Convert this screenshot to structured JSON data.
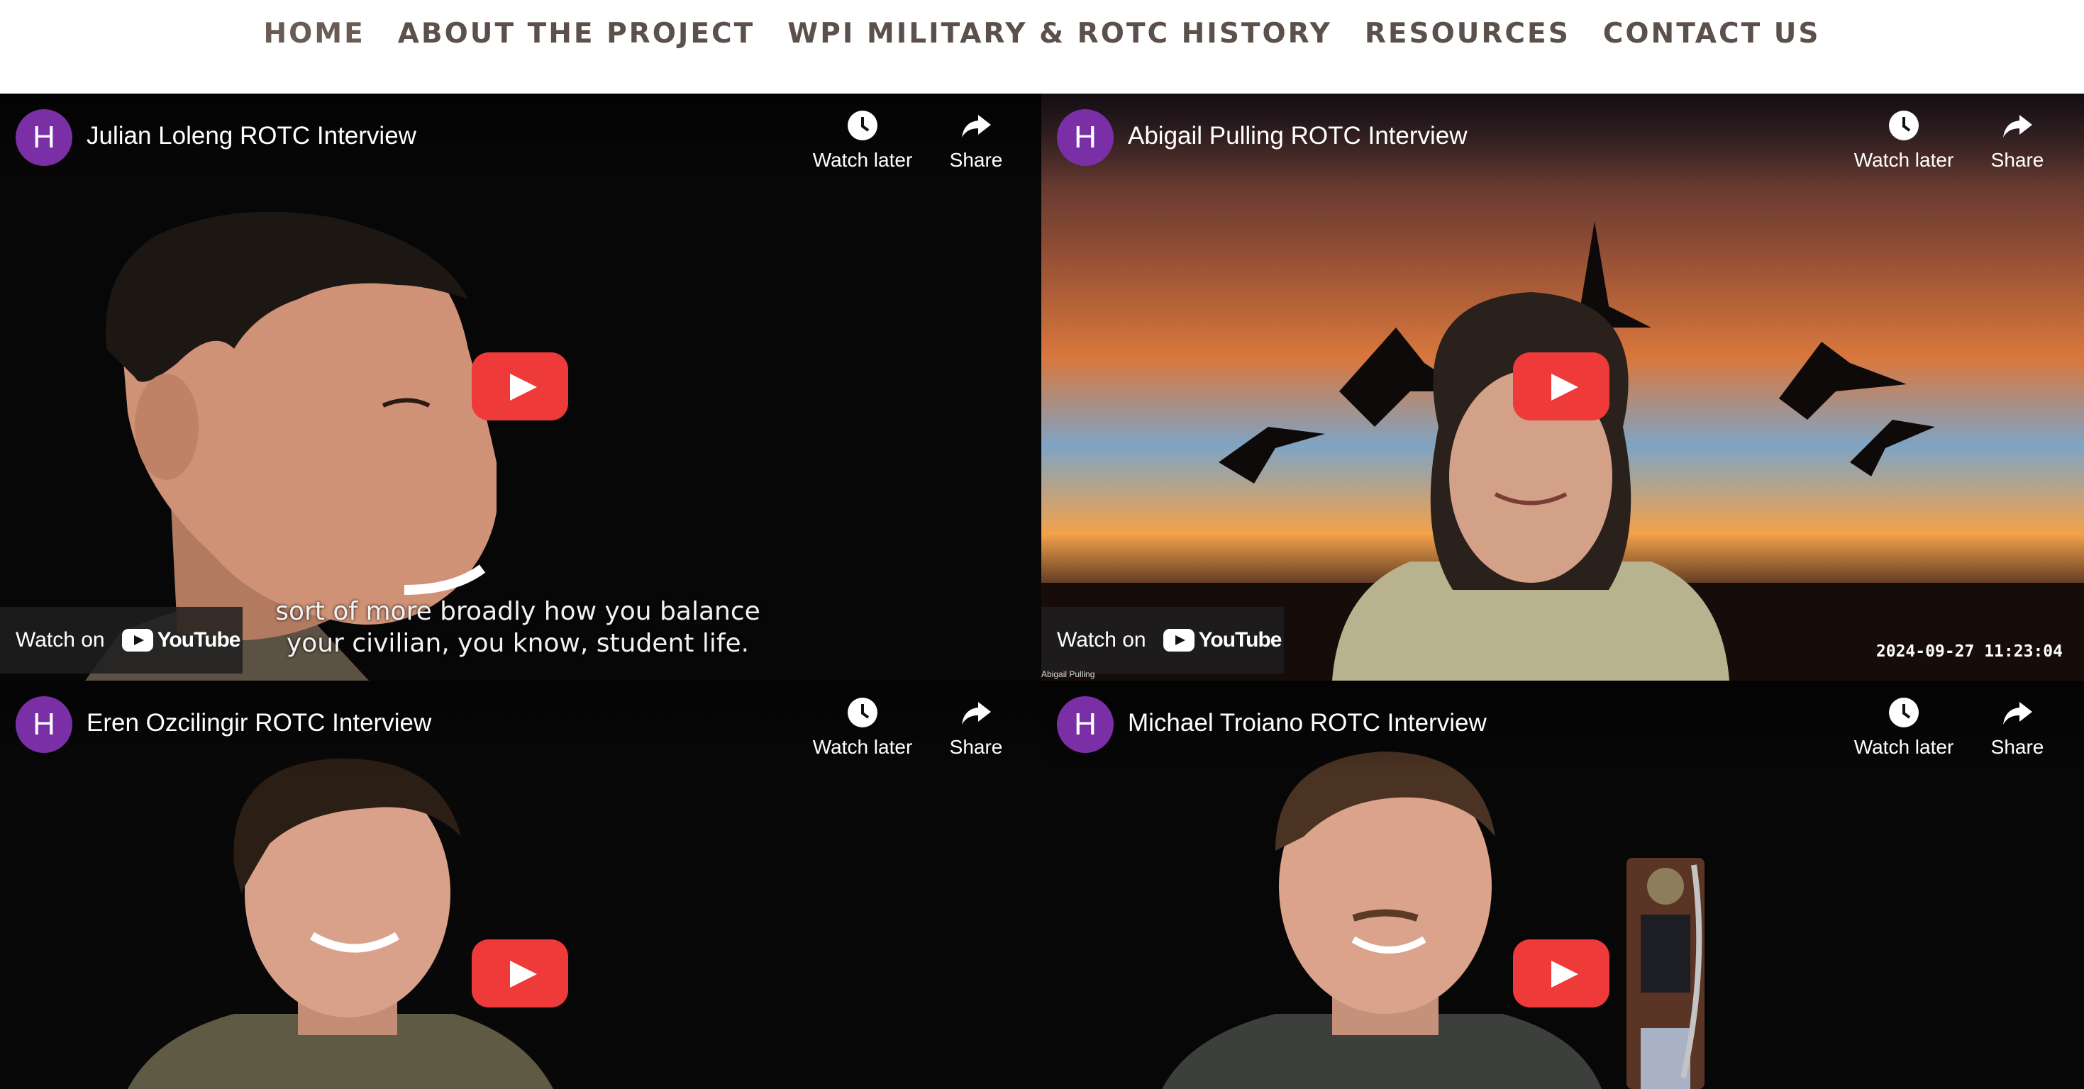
{
  "nav": {
    "items": [
      {
        "label": "HOME",
        "active": true
      },
      {
        "label": "ABOUT THE PROJECT",
        "active": false
      },
      {
        "label": "WPI MILITARY & ROTC HISTORY",
        "active": false
      },
      {
        "label": "RESOURCES",
        "active": false
      },
      {
        "label": "CONTACT US",
        "active": false
      }
    ]
  },
  "videos": [
    {
      "channel_initial": "H",
      "title": "Julian Loleng ROTC Interview",
      "watch_later": "Watch later",
      "share": "Share",
      "watch_on": "Watch on",
      "youtube_word": "YouTube",
      "subtitle_line1": "sort of more broadly how you balance",
      "subtitle_line2": "your civilian, you know, student life."
    },
    {
      "channel_initial": "H",
      "title": "Abigail Pulling ROTC Interview",
      "watch_later": "Watch later",
      "share": "Share",
      "watch_on": "Watch on",
      "youtube_word": "YouTube",
      "timestamp": "2024-09-27  11:23:04",
      "name_tag": "Abigail Pulling"
    },
    {
      "channel_initial": "H",
      "title": "Eren Ozcilingir ROTC Interview",
      "watch_later": "Watch later",
      "share": "Share"
    },
    {
      "channel_initial": "H",
      "title": "Michael Troiano ROTC Interview",
      "watch_later": "Watch later",
      "share": "Share"
    }
  ],
  "colors": {
    "nav_text": "#5b504b",
    "avatar": "#7b2fa6",
    "play_button": "#ef3a3a"
  },
  "icons": {
    "watch_later": "clock-icon",
    "share": "share-arrow-icon",
    "play": "play-icon",
    "youtube": "youtube-logo-icon"
  }
}
